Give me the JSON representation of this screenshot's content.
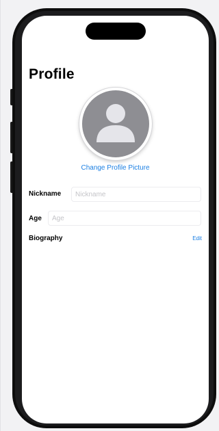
{
  "profile": {
    "title": "Profile",
    "change_picture_label": "Change Profile Picture",
    "avatar_icon": "person-placeholder-icon"
  },
  "fields": {
    "nickname": {
      "label": "Nickname",
      "placeholder": "Nickname",
      "value": ""
    },
    "age": {
      "label": "Age",
      "placeholder": "Age",
      "value": ""
    },
    "biography": {
      "label": "Biography",
      "edit_label": "Edit"
    }
  },
  "colors": {
    "accent": "#1b7fe3",
    "avatar_background": "#8e8e93",
    "avatar_glyph": "#e5e5ea"
  }
}
